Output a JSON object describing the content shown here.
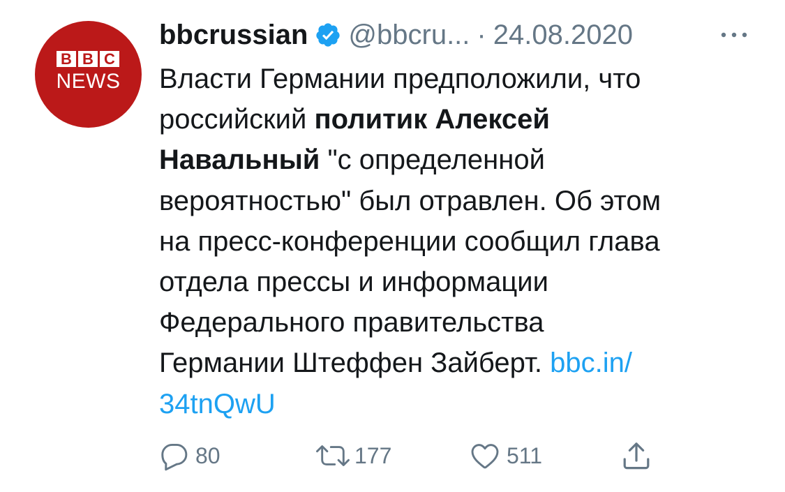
{
  "tweet": {
    "author": {
      "display_name": "bbcrussian",
      "handle": "@bbcru...",
      "verified": true,
      "avatar": {
        "blocks": [
          "B",
          "B",
          "C"
        ],
        "news": "NEWS",
        "background_color": "#bb1919"
      }
    },
    "separator": "·",
    "date": "24.08.2020",
    "more_icon": "more-dots-icon",
    "lines": [
      {
        "text": "Власти Германии предположили, что"
      },
      {
        "text": "российский ",
        "bold": "политик Алексей"
      },
      {
        "bold": "Навальный",
        "text": " \"с определенной"
      },
      {
        "text": "вероятностью\" был отравлен. Об этом"
      },
      {
        "text": "на пресс-конференции сообщил глава"
      },
      {
        "text": "отдела прессы и информации"
      },
      {
        "text": "Федерального правительства"
      },
      {
        "text": "Германии Штеффен Зайберт. ",
        "link": "bbc.in/"
      },
      {
        "link": "34tnQwU"
      }
    ],
    "link_color": "#1da1f2",
    "actions": {
      "reply": {
        "icon": "reply-icon",
        "count": "80"
      },
      "retweet": {
        "icon": "retweet-icon",
        "count": "177"
      },
      "like": {
        "icon": "heart-icon",
        "count": "511"
      },
      "share": {
        "icon": "share-icon"
      }
    },
    "muted_color": "#657786"
  }
}
